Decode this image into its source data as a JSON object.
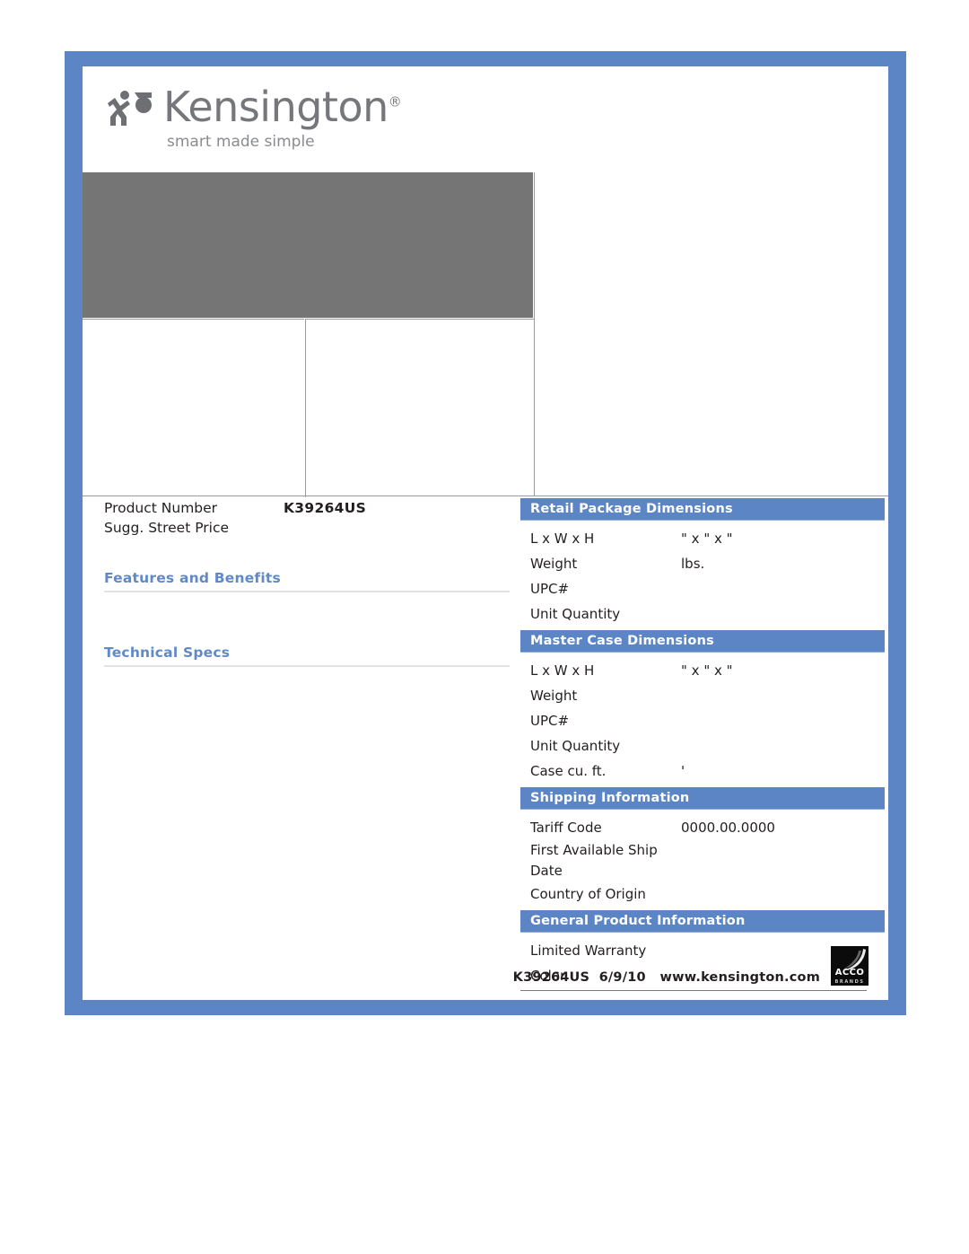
{
  "brand": {
    "logo_wordmark": "Kensington",
    "logo_registered": "®",
    "tagline": "smart made simple",
    "logo_icon": "kensington-figure-icon"
  },
  "product": {
    "product_number_label": "Product Number",
    "product_number_value": "K39264US",
    "street_price_label": "Sugg. Street Price",
    "street_price_value": ""
  },
  "left_sections": {
    "features_heading": "Features and Benefits",
    "features_body": "",
    "specs_heading": "Technical Specs",
    "specs_body": ""
  },
  "retail_package": {
    "heading": "Retail Package Dimensions",
    "rows": [
      {
        "label": "L x W x H",
        "value": "\" x \" x \""
      },
      {
        "label": "Weight",
        "value": "lbs."
      },
      {
        "label": "UPC#",
        "value": ""
      },
      {
        "label": "Unit Quantity",
        "value": ""
      }
    ]
  },
  "master_case": {
    "heading": "Master Case Dimensions",
    "rows": [
      {
        "label": "L x W x H",
        "value": "\" x \" x \""
      },
      {
        "label": "Weight",
        "value": ""
      },
      {
        "label": "UPC#",
        "value": ""
      },
      {
        "label": "Unit Quantity",
        "value": ""
      },
      {
        "label": "Case cu. ft.",
        "value": "'"
      }
    ]
  },
  "shipping": {
    "heading": "Shipping Information",
    "rows": [
      {
        "label": "Tariff Code",
        "value": "0000.00.0000"
      },
      {
        "label": "First Available Ship Date",
        "value": ""
      },
      {
        "label": "Country of Origin",
        "value": ""
      }
    ]
  },
  "general": {
    "heading": "General Product Information",
    "rows": [
      {
        "label": "Limited Warranty",
        "value": ""
      },
      {
        "label": "Color",
        "value": ""
      }
    ]
  },
  "footer": {
    "text": "K39264US  6/9/10   www.kensington.com",
    "acco_name": "ACCO",
    "acco_sub": "BRANDS",
    "acco_icon": "acco-brands-logo"
  },
  "colors": {
    "frame_blue": "#5B85C5",
    "header_blue": "#5B85C5",
    "heading_blue": "#6189C8",
    "image_gray": "#757575",
    "logo_gray": "#76777A"
  }
}
